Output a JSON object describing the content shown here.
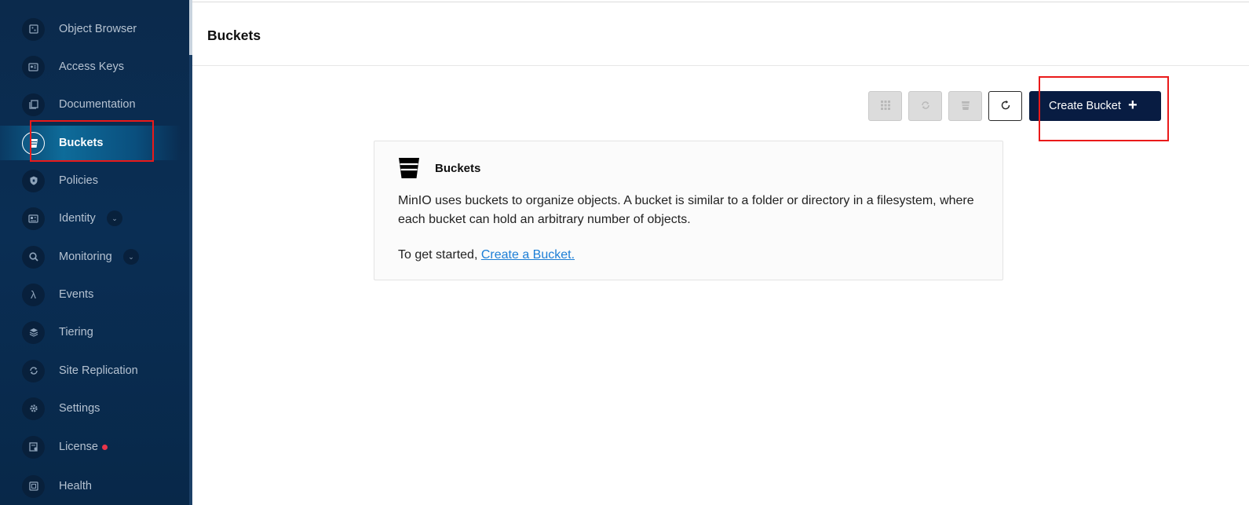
{
  "sidebar": {
    "items": [
      {
        "label": "Object Browser",
        "icon": "object-browser-icon"
      },
      {
        "label": "Access Keys",
        "icon": "access-keys-icon"
      },
      {
        "label": "Documentation",
        "icon": "documentation-icon"
      },
      {
        "label": "Buckets",
        "icon": "bucket-icon",
        "active": true
      },
      {
        "label": "Policies",
        "icon": "shield-icon"
      },
      {
        "label": "Identity",
        "icon": "identity-icon",
        "expandable": true
      },
      {
        "label": "Monitoring",
        "icon": "monitoring-icon",
        "expandable": true
      },
      {
        "label": "Events",
        "icon": "lambda-icon"
      },
      {
        "label": "Tiering",
        "icon": "layers-icon"
      },
      {
        "label": "Site Replication",
        "icon": "replication-icon"
      },
      {
        "label": "Settings",
        "icon": "gear-icon"
      },
      {
        "label": "License",
        "icon": "license-icon",
        "notification_dot": true
      },
      {
        "label": "Health",
        "icon": "health-icon"
      }
    ]
  },
  "header": {
    "title": "Buckets"
  },
  "toolbar": {
    "buttons": [
      {
        "icon": "grid-icon",
        "disabled": true
      },
      {
        "icon": "sync-icon",
        "disabled": true
      },
      {
        "icon": "bucket-list-icon",
        "disabled": true
      },
      {
        "icon": "refresh-icon",
        "disabled": false
      }
    ],
    "create_label": "Create Bucket",
    "create_icon": "plus-icon"
  },
  "info_card": {
    "title": "Buckets",
    "description": "MinIO uses buckets to organize objects. A bucket is similar to a folder or directory in a filesystem, where each bucket can hold an arbitrary number of objects.",
    "cta_prefix": "To get started,",
    "cta_link": "Create a Bucket."
  },
  "colors": {
    "sidebar_bg": "#0a2e54",
    "active_item": "#0e6c9a",
    "primary_button": "#081c42",
    "link": "#1c7ed6",
    "annotation": "#ea1a1a",
    "notification_dot": "#e8354a"
  }
}
